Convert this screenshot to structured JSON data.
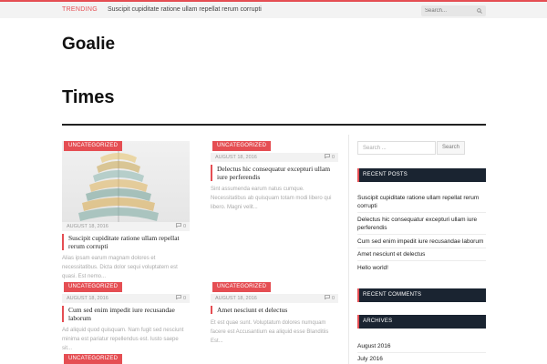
{
  "topbar": {
    "trending_label": "TRENDING",
    "trending_text": "Suscipit cupiditate ratione ullam repellat rerum corrupti",
    "search_placeholder": "Search..."
  },
  "site": {
    "logo": "Goalie",
    "page_title": "Times"
  },
  "posts": [
    {
      "category": "UNCATEGORIZED",
      "date": "AUGUST 18, 2016",
      "comments": "0",
      "title": "Suscipit cupiditate ratione ullam repellat rerum corrupti",
      "excerpt": "Alias ipsam earum magnam dolores et necessitatibus. Dicta dolor sequi voluptatem est quasi. Est nemo..."
    },
    {
      "category": "UNCATEGORIZED",
      "date": "AUGUST 18, 2016",
      "comments": "0",
      "title": "Delectus hic consequatur excepturi ullam iure perferendis",
      "excerpt": "Sint assumenda earum natus cumque. Necessitatibus ab quisquam totam modi libero qui libero. Magni velit..."
    },
    {
      "category": "UNCATEGORIZED",
      "date": "AUGUST 18, 2016",
      "comments": "0",
      "title": "Cum sed enim impedit iure recusandae laborum",
      "excerpt": "Ad aliquid quod quisquam. Nam fugit sed nesciunt minima est pariatur repellendus est. Iusto saepe sit..."
    },
    {
      "category": "UNCATEGORIZED",
      "date": "AUGUST 18, 2016",
      "comments": "0",
      "title": "Amet nesciunt et delectus",
      "excerpt": "Et est quae sunt. Voluptatum dolores numquam facere est Accusantium ea aliquid esse Blanditiis Est..."
    },
    {
      "category": "UNCATEGORIZED"
    }
  ],
  "sidebar": {
    "search_placeholder": "Search ...",
    "search_button": "Search",
    "recent_posts_title": "RECENT POSTS",
    "recent_posts": [
      "Suscipit cupiditate ratione ullam repellat rerum corrupti",
      "Delectus hic consequatur excepturi ullam iure perferendis",
      "Cum sed enim impedit iure recusandae laborum",
      "Amet nesciunt et delectus",
      "Hello world!"
    ],
    "recent_comments_title": "RECENT COMMENTS",
    "archives_title": "ARCHIVES",
    "archives": [
      "August 2016",
      "July 2016"
    ]
  },
  "colors": {
    "accent": "#e54e53",
    "widget_header": "#1a2431"
  }
}
